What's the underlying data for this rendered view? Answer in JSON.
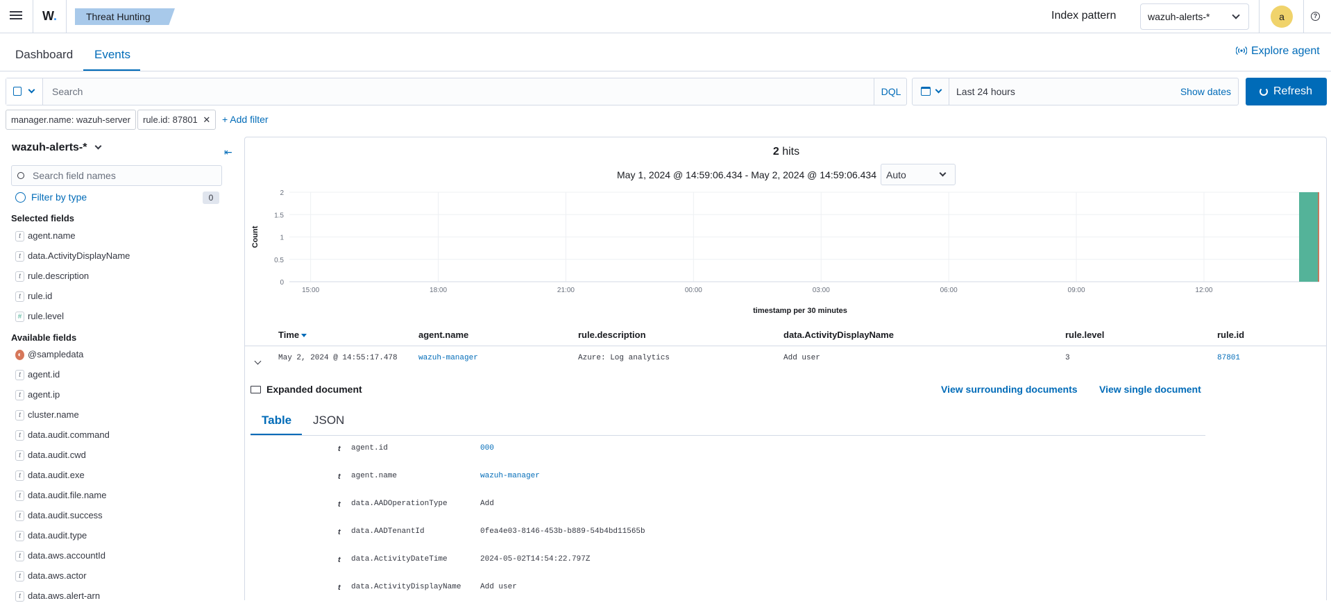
{
  "header": {
    "logo": "W",
    "breadcrumb": "Threat Hunting",
    "index_pattern_label": "Index pattern",
    "index_pattern_value": "wazuh-alerts-*",
    "avatar_letter": "a",
    "help_glyph": "?"
  },
  "tabs": [
    "Dashboard",
    "Events"
  ],
  "explore_agent": "Explore agent",
  "search": {
    "placeholder": "Search",
    "language": "DQL",
    "date_range": "Last 24 hours",
    "show_dates": "Show dates",
    "refresh": "Refresh"
  },
  "filters": [
    "manager.name: wazuh-server",
    "rule.id: 87801"
  ],
  "add_filter": "+ Add filter",
  "sidebar": {
    "index": "wazuh-alerts-*",
    "field_search_placeholder": "Search field names",
    "filter_by_type": "Filter by type",
    "filter_count": "0",
    "selected_title": "Selected fields",
    "available_title": "Available fields",
    "selected_fields": [
      {
        "type": "t",
        "name": "agent.name"
      },
      {
        "type": "t",
        "name": "data.ActivityDisplayName"
      },
      {
        "type": "t",
        "name": "rule.description"
      },
      {
        "type": "t",
        "name": "rule.id"
      },
      {
        "type": "#",
        "name": "rule.level"
      }
    ],
    "available_fields": [
      {
        "type": "geo",
        "name": "@sampledata"
      },
      {
        "type": "t",
        "name": "agent.id"
      },
      {
        "type": "t",
        "name": "agent.ip"
      },
      {
        "type": "t",
        "name": "cluster.name"
      },
      {
        "type": "t",
        "name": "data.audit.command"
      },
      {
        "type": "t",
        "name": "data.audit.cwd"
      },
      {
        "type": "t",
        "name": "data.audit.exe"
      },
      {
        "type": "t",
        "name": "data.audit.file.name"
      },
      {
        "type": "t",
        "name": "data.audit.success"
      },
      {
        "type": "t",
        "name": "data.audit.type"
      },
      {
        "type": "t",
        "name": "data.aws.accountId"
      },
      {
        "type": "t",
        "name": "data.aws.actor"
      },
      {
        "type": "t",
        "name": "data.aws.alert-arn"
      }
    ]
  },
  "results": {
    "hits_count": "2",
    "hits_label": "hits",
    "range": "May 1, 2024 @ 14:59:06.434 - May 2, 2024 @ 14:59:06.434",
    "interval": "Auto"
  },
  "chart_data": {
    "type": "bar",
    "xlabel": "timestamp per 30 minutes",
    "ylabel": "Count",
    "ylim": [
      0,
      2
    ],
    "yticks": [
      "0",
      "0.5",
      "1",
      "1.5",
      "2"
    ],
    "xticks": [
      "15:00",
      "18:00",
      "21:00",
      "00:00",
      "03:00",
      "06:00",
      "09:00",
      "12:00"
    ],
    "bars": [
      {
        "x": "14:30",
        "value": 2
      }
    ],
    "bar_color": "#54b399",
    "grid": true,
    "legend": "none"
  },
  "table": {
    "columns": [
      "Time",
      "agent.name",
      "rule.description",
      "data.ActivityDisplayName",
      "rule.level",
      "rule.id"
    ],
    "row": [
      "May 2, 2024 @ 14:55:17.478",
      "wazuh-manager",
      "Azure: Log analytics",
      "Add user",
      "3",
      "87801"
    ]
  },
  "expanded": {
    "title": "Expanded document",
    "view_surrounding": "View surrounding documents",
    "view_single": "View single document",
    "tabs": [
      "Table",
      "JSON"
    ],
    "type_glyph": "t",
    "rows": [
      {
        "key": "agent.id",
        "value": "000",
        "link": true
      },
      {
        "key": "agent.name",
        "value": "wazuh-manager",
        "link": true
      },
      {
        "key": "data.AADOperationType",
        "value": "Add",
        "link": false
      },
      {
        "key": "data.AADTenantId",
        "value": "0fea4e03-8146-453b-b889-54b4bd11565b",
        "link": false
      },
      {
        "key": "data.ActivityDateTime",
        "value": "2024-05-02T14:54:22.797Z",
        "link": false
      },
      {
        "key": "data.ActivityDisplayName",
        "value": "Add user",
        "link": false
      }
    ]
  }
}
